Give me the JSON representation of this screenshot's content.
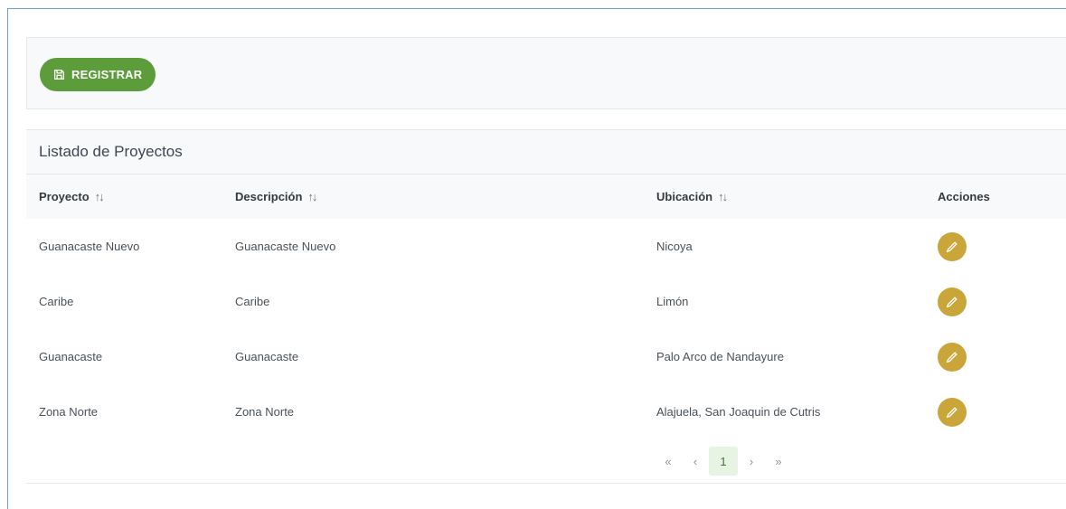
{
  "toolbar": {
    "register_label": "REGISTRAR"
  },
  "list": {
    "title": "Listado de Proyectos",
    "columns": [
      "Proyecto",
      "Descripción",
      "Ubicación",
      "Acciones"
    ],
    "sort_indicator": "↑↓",
    "rows": [
      {
        "proyecto": "Guanacaste Nuevo",
        "descripcion": "Guanacaste Nuevo",
        "ubicacion": "Nicoya"
      },
      {
        "proyecto": "Caribe",
        "descripcion": "Caribe",
        "ubicacion": "Limón"
      },
      {
        "proyecto": "Guanacaste",
        "descripcion": "Guanacaste",
        "ubicacion": "Palo Arco de Nandayure"
      },
      {
        "proyecto": "Zona Norte",
        "descripcion": "Zona Norte",
        "ubicacion": "Alajuela, San Joaquin de Cutris"
      }
    ]
  },
  "pagination": {
    "first": "«",
    "prev": "‹",
    "current_page": "1",
    "next": "›",
    "last": "»"
  },
  "colors": {
    "primary": "#5d9c3a",
    "edit": "#c9a53a",
    "frame": "#6ea0d8"
  },
  "icons": {
    "register": "save-icon",
    "edit": "pencil-icon"
  }
}
